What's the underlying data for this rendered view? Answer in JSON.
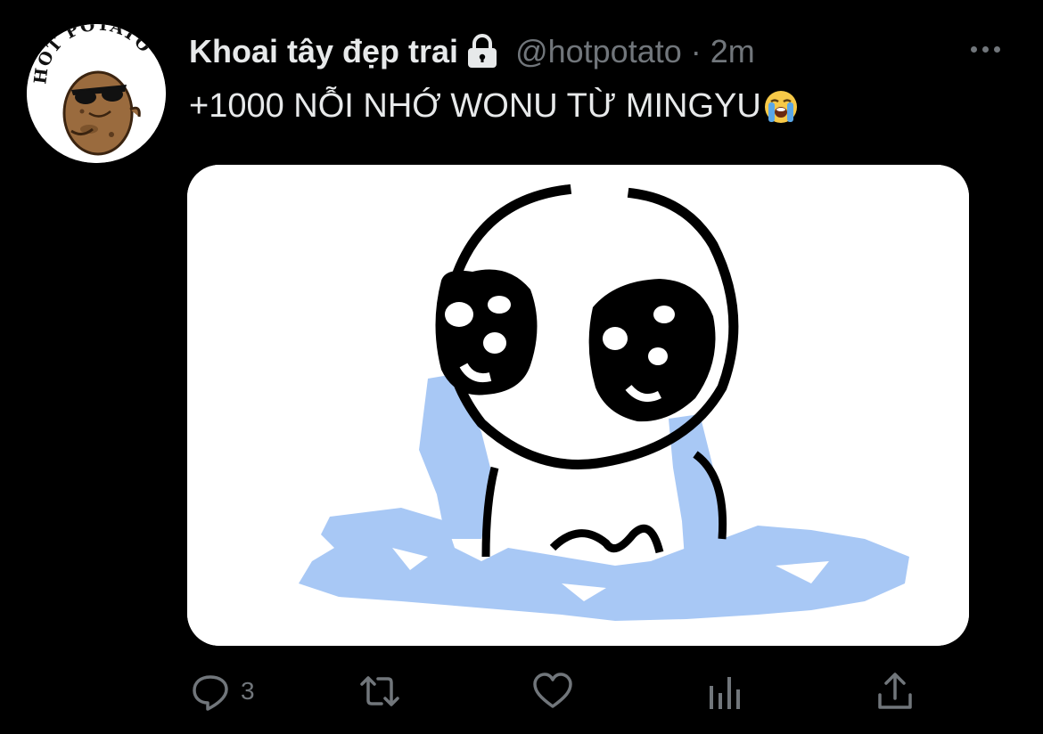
{
  "account": {
    "display_name": "Khoai tây đẹp trai",
    "handle": "@hotpotato",
    "separator": "·",
    "time": "2m",
    "avatar_text": "HOT POTATO",
    "protected_icon": "lock-icon"
  },
  "tweet": {
    "text": "+1000 NỖI NHỚ WONU TỪ MINGYU",
    "emoji": "loudly-crying-face-emoji"
  },
  "actions": {
    "reply_icon": "reply-icon",
    "reply_count": "3",
    "retweet_icon": "retweet-icon",
    "like_icon": "heart-icon",
    "analytics_icon": "analytics-icon",
    "share_icon": "share-icon"
  },
  "more_icon": "more-horizontal-icon",
  "colors": {
    "background": "#000000",
    "primary_text": "#e7e9ea",
    "secondary_text": "#71767b",
    "tears": "#a8c8f5"
  }
}
